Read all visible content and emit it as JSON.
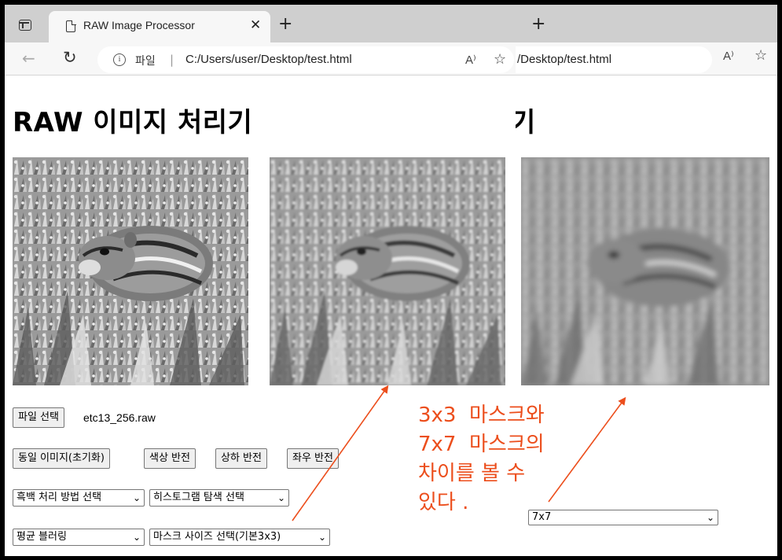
{
  "browser": {
    "tab_title": "RAW Image Processor",
    "tab_close": "✕",
    "new_tab": "+",
    "address_label": "파일",
    "address_separator": "|",
    "address_url": "C:/Users/user/Desktop/test.html",
    "read_aloud": "A⁾",
    "favorite": "☆",
    "back": "←",
    "reload": "↻"
  },
  "second_window": {
    "address_url": "/Desktop/test.html",
    "title_fragment": "기",
    "new_tab": "+",
    "mask_select_value": "7x7"
  },
  "page": {
    "title": "RAW 이미지 처리기",
    "file_button": "파일 선택",
    "file_name": "etc13_256.raw",
    "buttons": {
      "same_image": "동일 이미지(초기화)",
      "color_invert": "색상 반전",
      "flip_vertical": "상하 반전",
      "flip_horizontal": "좌우 반전"
    },
    "selects": {
      "bw_method": "흑백 처리 방법 선택",
      "histogram": "히스토그램 탐색 선택",
      "blur": "평균 블러링",
      "mask_size": "마스크 사이즈 선택(기본3x3)"
    }
  },
  "annotation": {
    "text": "3x3  마스크와\n7x7  마스크의\n차이를 볼 수\n있다 .",
    "color": "#ec4e1c"
  },
  "images": {
    "original": "chipmunk-original",
    "blur_3x3": "chipmunk-blur-3x3",
    "blur_7x7": "chipmunk-blur-7x7"
  }
}
